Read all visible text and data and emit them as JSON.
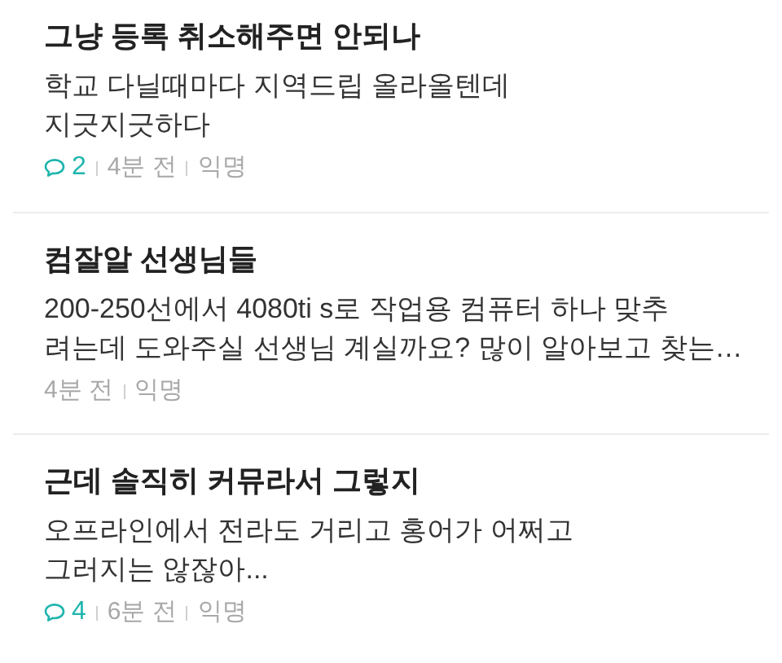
{
  "posts": [
    {
      "title": "그냥 등록 취소해주면 안되나",
      "body_lines": [
        "학교 다닐때마다 지역드립 올라올텐데",
        "지긋지긋하다"
      ],
      "comments": "2",
      "time": "4분 전",
      "author": "익명"
    },
    {
      "title": "컴잘알 선생님들",
      "body_lines": [
        "200-250선에서 4080ti s로 작업용 컴퓨터 하나 맞추",
        "려는데 도와주실 선생님 계실까요? 많이 알아보고 찾는…"
      ],
      "time": "4분 전",
      "author": "익명"
    },
    {
      "title": "근데 솔직히 커뮤라서 그렇지",
      "body_lines": [
        "오프라인에서 전라도 거리고 홍어가 어쩌고",
        "그러지는 않잖아..."
      ],
      "comments": "4",
      "time": "6분 전",
      "author": "익명"
    }
  ]
}
